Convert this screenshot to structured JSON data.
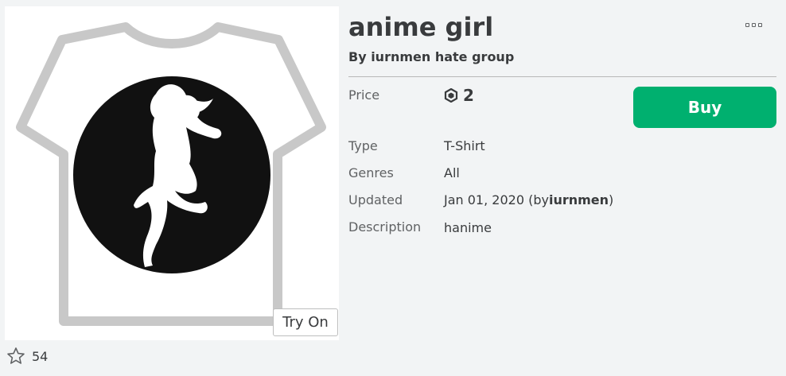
{
  "item": {
    "title": "anime girl",
    "creator_text": "By iurnmen hate group",
    "thumbnail_icon": "tshirt-template-silhouette-image",
    "try_on_label": "Try On",
    "favorites_count": "54"
  },
  "details": {
    "price_label": "Price",
    "price_value": "2",
    "currency_icon": "robux-icon",
    "buy_label": "Buy",
    "type_label": "Type",
    "type_value": "T-Shirt",
    "genres_label": "Genres",
    "genres_value": "All",
    "updated_label": "Updated",
    "updated_date": "Jan 01, 2020",
    "updated_by_prefix": "(by",
    "updated_by_user": "iurnmen",
    "updated_by_suffix": ")",
    "description_label": "Description",
    "description_value": "hanime"
  },
  "colors": {
    "buy_button": "#00b06f",
    "background": "#f2f4f5",
    "text": "#393b3d",
    "muted_text": "#606264"
  }
}
